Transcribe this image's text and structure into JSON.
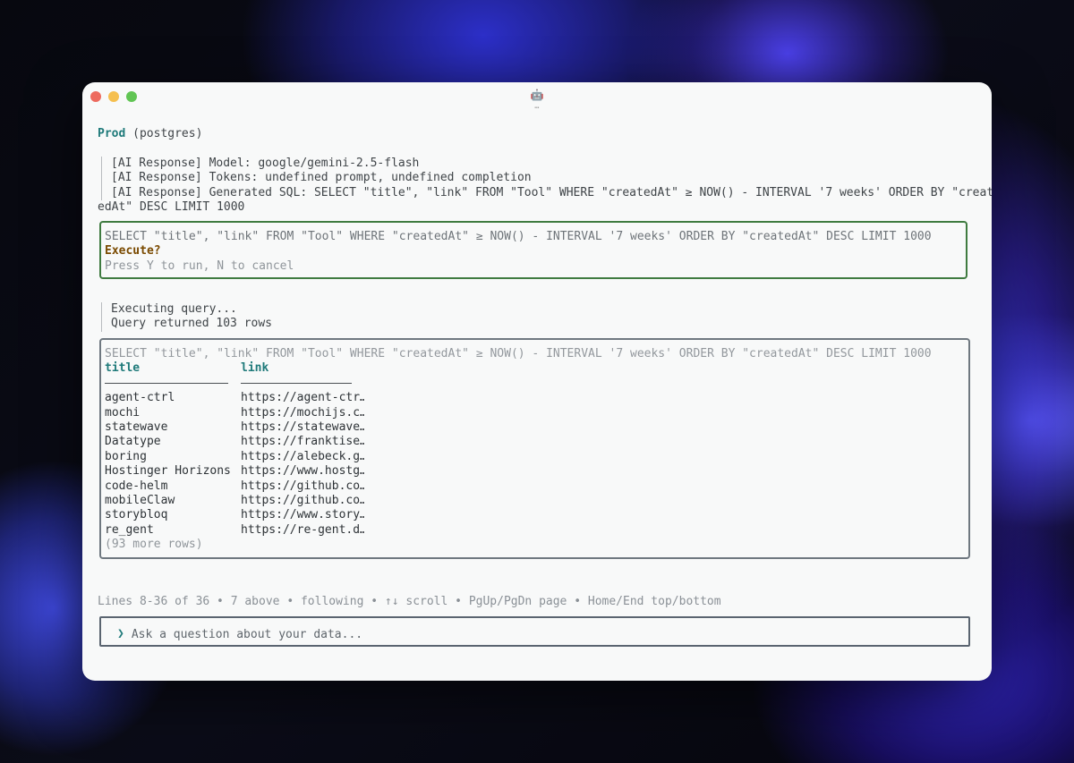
{
  "window": {
    "title_icon": "🤖",
    "title_dots": "⋯"
  },
  "connection": {
    "name": "Prod",
    "engine": "(postgres)"
  },
  "ai_log": [
    "[AI Response] Model: google/gemini-2.5-flash",
    "[AI Response] Tokens: undefined prompt, undefined completion",
    "[AI Response] Generated SQL: SELECT \"title\", \"link\" FROM \"Tool\" WHERE \"createdAt\" ≥ NOW() - INTERVAL '7 weeks' ORDER BY \"creat"
  ],
  "ai_log_wrap": "edAt\" DESC LIMIT 1000",
  "confirm": {
    "sql": "SELECT \"title\", \"link\" FROM \"Tool\" WHERE \"createdAt\" ≥ NOW() - INTERVAL '7 weeks' ORDER BY \"createdAt\" DESC LIMIT 1000",
    "prompt": "Execute?",
    "hint": "Press Y to run, N to cancel"
  },
  "exec_log": [
    "Executing query...",
    "Query returned 103 rows"
  ],
  "result": {
    "sql": "SELECT \"title\", \"link\" FROM \"Tool\" WHERE \"createdAt\" ≥ NOW() - INTERVAL '7 weeks' ORDER BY \"createdAt\" DESC LIMIT 1000",
    "columns": [
      "title",
      "link"
    ],
    "rows": [
      [
        "agent-ctrl",
        "https://agent-ctr…"
      ],
      [
        "mochi",
        "https://mochijs.c…"
      ],
      [
        "statewave",
        "https://statewave…"
      ],
      [
        "Datatype",
        "https://franktise…"
      ],
      [
        "boring",
        "https://alebeck.g…"
      ],
      [
        "Hostinger Horizons",
        "https://www.hostg…"
      ],
      [
        "code-helm",
        "https://github.co…"
      ],
      [
        "mobileClaw",
        "https://github.co…"
      ],
      [
        "storybloq",
        "https://www.story…"
      ],
      [
        "re_gent",
        "https://re-gent.d…"
      ]
    ],
    "more_rows": "(93 more rows)"
  },
  "status_bar": "Lines 8-36 of 36 • 7 above • following • ↑↓ scroll • PgUp/PgDn page • Home/End top/bottom",
  "input": {
    "prompt_glyph": "❯",
    "placeholder": "Ask a question about your data..."
  }
}
